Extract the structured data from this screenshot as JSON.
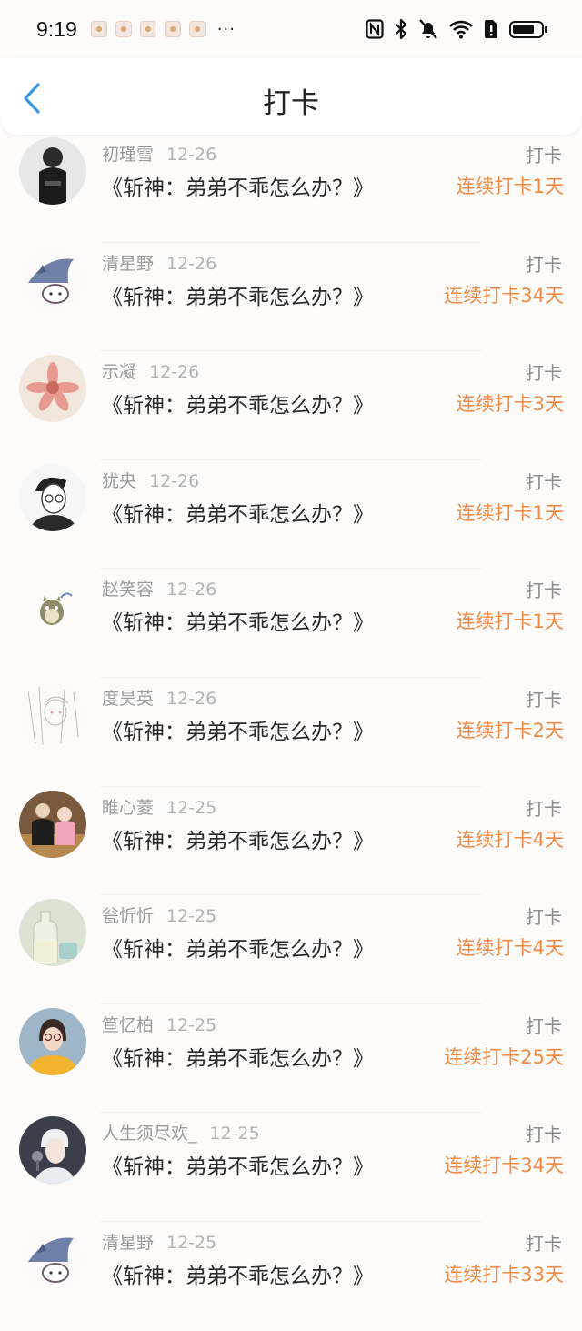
{
  "status_bar": {
    "time": "9:19",
    "more": "···"
  },
  "nav": {
    "title": "打卡"
  },
  "colors": {
    "accent": "#ef8a47",
    "back": "#3a97e6"
  },
  "items": [
    {
      "name": "初瑾雪",
      "date": "12-26",
      "book": "《斩神：弟弟不乖怎么办？》",
      "action": "打卡",
      "streak": "连续打卡1天",
      "avatar": "dark-outfit-photo"
    },
    {
      "name": "清星野",
      "date": "12-26",
      "book": "《斩神：弟弟不乖怎么办？》",
      "action": "打卡",
      "streak": "连续打卡34天",
      "avatar": "shark-cartoon"
    },
    {
      "name": "示凝",
      "date": "12-26",
      "book": "《斩神：弟弟不乖怎么办？》",
      "action": "打卡",
      "streak": "连续打卡3天",
      "avatar": "pink-flower"
    },
    {
      "name": "犹央",
      "date": "12-26",
      "book": "《斩神：弟弟不乖怎么办？》",
      "action": "打卡",
      "streak": "连续打卡1天",
      "avatar": "sketch-boy"
    },
    {
      "name": "赵笑容",
      "date": "12-26",
      "book": "《斩神：弟弟不乖怎么办？》",
      "action": "打卡",
      "streak": "连续打卡1天",
      "avatar": "totoro"
    },
    {
      "name": "度昊英",
      "date": "12-26",
      "book": "《斩神：弟弟不乖怎么办？》",
      "action": "打卡",
      "streak": "连续打卡2天",
      "avatar": "sketch-girl"
    },
    {
      "name": "睢心菱",
      "date": "12-25",
      "book": "《斩神：弟弟不乖怎么办？》",
      "action": "打卡",
      "streak": "连续打卡4天",
      "avatar": "couple-photo"
    },
    {
      "name": "瓮忻忻",
      "date": "12-25",
      "book": "《斩神：弟弟不乖怎么办？》",
      "action": "打卡",
      "streak": "连续打卡4天",
      "avatar": "glass-bottle"
    },
    {
      "name": "笪忆柏",
      "date": "12-25",
      "book": "《斩神：弟弟不乖怎么办？》",
      "action": "打卡",
      "streak": "连续打卡25天",
      "avatar": "girl-yellow-shirt"
    },
    {
      "name": "人生须尽欢_",
      "date": "12-25",
      "book": "《斩神：弟弟不乖怎么办？》",
      "action": "打卡",
      "streak": "连续打卡34天",
      "avatar": "boy-microphone"
    },
    {
      "name": "清星野",
      "date": "12-25",
      "book": "《斩神：弟弟不乖怎么办？》",
      "action": "打卡",
      "streak": "连续打卡33天",
      "avatar": "shark-cartoon"
    }
  ]
}
